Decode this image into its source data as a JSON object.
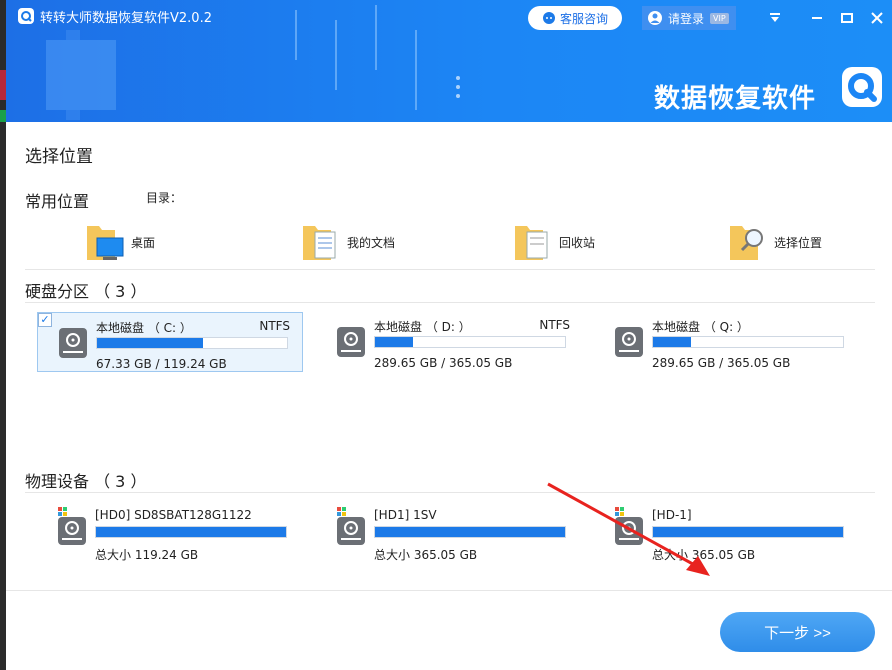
{
  "app": {
    "title": "转转大师数据恢复软件V2.0.2",
    "service_label": "客服咨询",
    "login_label": "请登录",
    "vip_label": "VIP",
    "brand_text": "数据恢复软件",
    "accent_color": "#1c86f5"
  },
  "page": {
    "title": "选择位置",
    "next_label": "下一步 >>"
  },
  "common": {
    "title": "常用位置",
    "dir_label": "目录：",
    "items": [
      {
        "label": "桌面",
        "icon": "desktop-folder-icon"
      },
      {
        "label": "我的文档",
        "icon": "documents-folder-icon"
      },
      {
        "label": "回收站",
        "icon": "recycle-folder-icon"
      },
      {
        "label": "选择位置",
        "icon": "search-folder-icon"
      }
    ]
  },
  "partitions": {
    "title": "硬盘分区 （ 3 ）",
    "items": [
      {
        "name": "本地磁盘 （ C: ）",
        "fs": "NTFS",
        "size": "67.33 GB / 119.24 GB",
        "used_fraction": 0.56,
        "selected": true
      },
      {
        "name": "本地磁盘 （ D: ）",
        "fs": "NTFS",
        "size": "289.65 GB / 365.05 GB",
        "used_fraction": 0.2,
        "selected": false
      },
      {
        "name": "本地磁盘 （ Q: ）",
        "fs": "",
        "size": "289.65 GB / 365.05 GB",
        "used_fraction": 0.2,
        "selected": false
      }
    ]
  },
  "devices": {
    "title": "物理设备 （ 3 ）",
    "items": [
      {
        "name": "[HD0] SD8SBAT128G1122",
        "size": "总大小 119.24 GB",
        "used_fraction": 1.0
      },
      {
        "name": "[HD1] 1SV",
        "size": "总大小 365.05 GB",
        "used_fraction": 1.0
      },
      {
        "name": "[HD-1]",
        "size": "总大小 365.05 GB",
        "used_fraction": 1.0
      }
    ]
  }
}
